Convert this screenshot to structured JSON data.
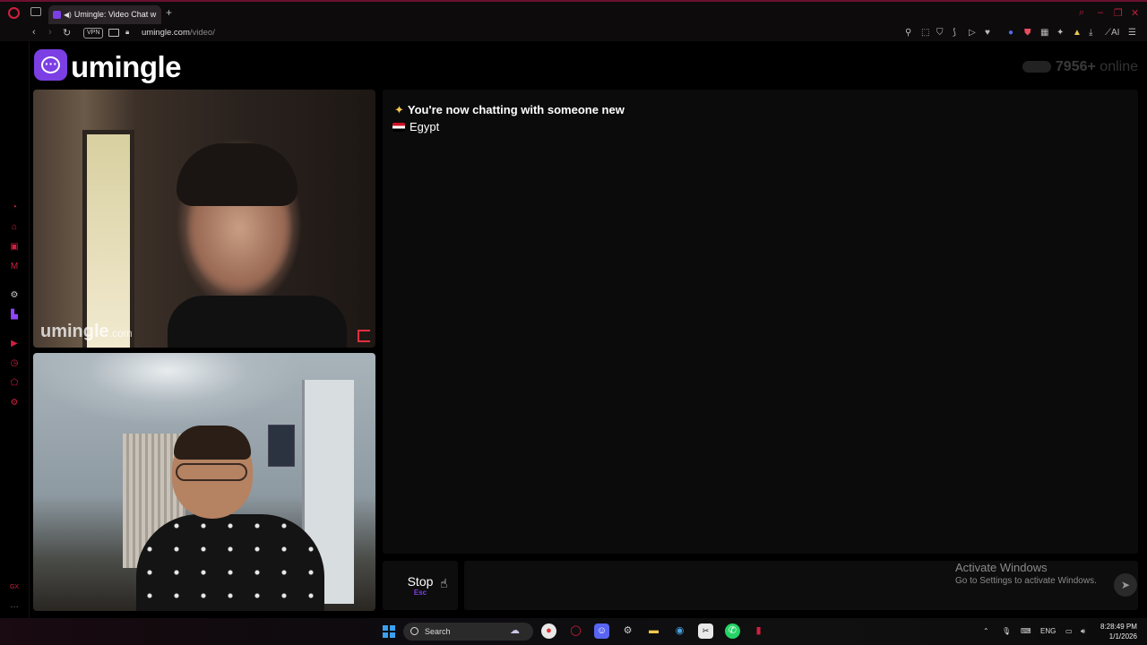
{
  "browser": {
    "tab_title": "Umingle: Video Chat w",
    "new_tab": "+",
    "vpn_label": "VPN",
    "url_host": "umingle.com",
    "url_path": "/video/",
    "icons": [
      "back-icon",
      "forward-icon",
      "reload-icon",
      "camera-icon",
      "lock-icon"
    ],
    "window_controls": [
      "search",
      "minimize",
      "restore",
      "close"
    ]
  },
  "header": {
    "logo_text": "umingle",
    "online_count": "7956+",
    "online_label": "online"
  },
  "videos": {
    "stranger_watermark_main": "umingle",
    "stranger_watermark_suffix": ".com"
  },
  "chat": {
    "status_message": "You're now chatting with someone new",
    "country": "Egypt",
    "flag_colors": [
      "#ce1126",
      "#ffffff",
      "#000000"
    ]
  },
  "controls": {
    "stop_label": "Stop",
    "stop_shortcut": "Esc"
  },
  "windows_activation": {
    "title": "Activate Windows",
    "subtitle": "Go to Settings to activate Windows."
  },
  "taskbar": {
    "search_placeholder": "Search",
    "language": "ENG",
    "time": "8:28:49 PM",
    "date": "1/1/2026"
  },
  "colors": {
    "brand": "#7b3fe4",
    "opera_red": "#d02040"
  }
}
